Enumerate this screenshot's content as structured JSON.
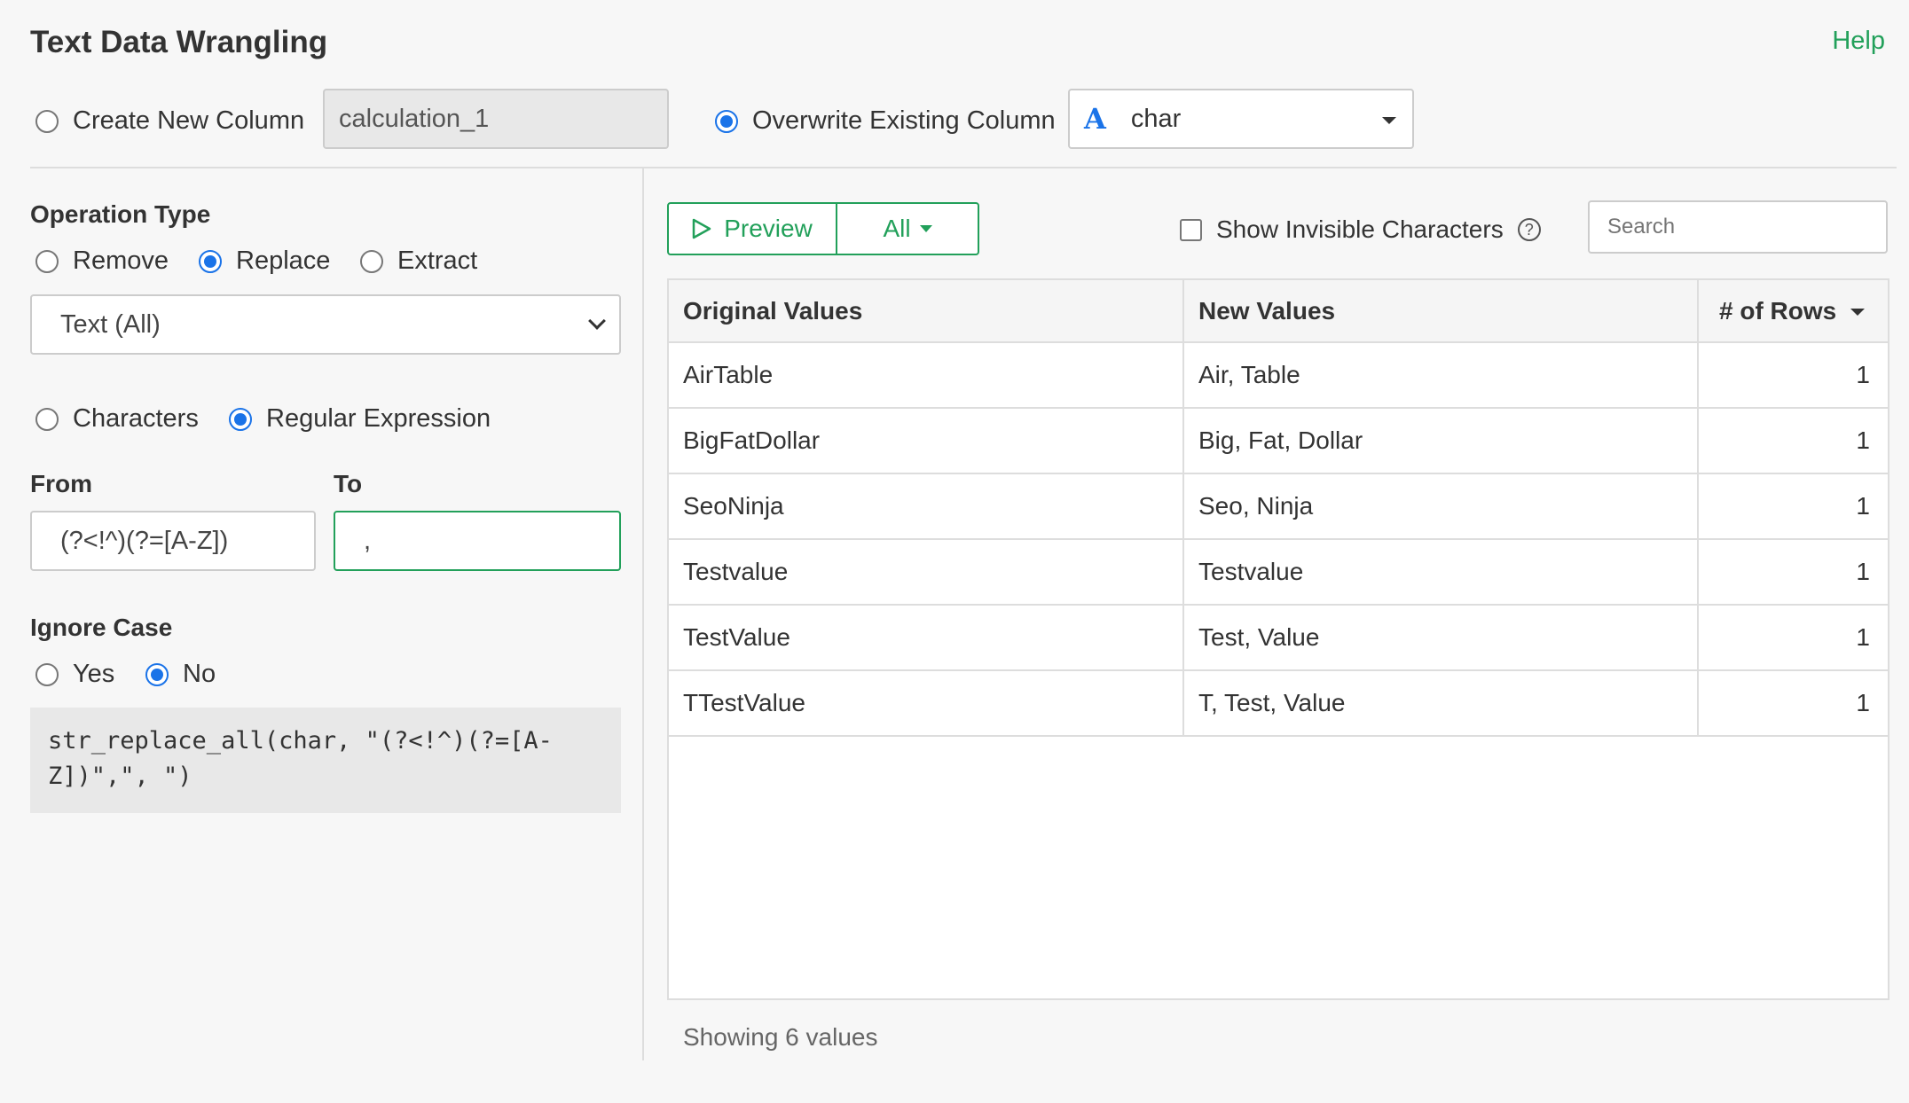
{
  "header": {
    "title": "Text Data Wrangling",
    "help_label": "Help"
  },
  "column_mode": {
    "create_label": "Create New Column",
    "create_value": "calculation_1",
    "overwrite_label": "Overwrite Existing Column",
    "selected": "overwrite",
    "column_type_icon": "A",
    "column_name": "char"
  },
  "operation": {
    "label": "Operation Type",
    "options": [
      "Remove",
      "Replace",
      "Extract"
    ],
    "selected": "Replace",
    "target_select": "Text (All)"
  },
  "match_mode": {
    "options": [
      "Characters",
      "Regular Expression"
    ],
    "selected": "Regular Expression"
  },
  "replace": {
    "from_label": "From",
    "from_value": "(?<!^)(?=[A-Z])",
    "to_label": "To",
    "to_value": ","
  },
  "ignore_case": {
    "label": "Ignore Case",
    "options": [
      "Yes",
      "No"
    ],
    "selected": "No"
  },
  "code": "str_replace_all(char, \"(?<!^)(?=[A-Z])\",\", \")",
  "toolbar": {
    "preview_label": "Preview",
    "filter_label": "All",
    "invisible_label": "Show Invisible Characters",
    "search_placeholder": "Search"
  },
  "table": {
    "headers": [
      "Original Values",
      "New Values",
      "# of Rows"
    ],
    "rows": [
      {
        "original": "AirTable",
        "new": "Air, Table",
        "count": "1"
      },
      {
        "original": "BigFatDollar",
        "new": "Big, Fat, Dollar",
        "count": "1"
      },
      {
        "original": "SeoNinja",
        "new": "Seo, Ninja",
        "count": "1"
      },
      {
        "original": "Testvalue",
        "new": "Testvalue",
        "count": "1"
      },
      {
        "original": "TestValue",
        "new": "Test, Value",
        "count": "1"
      },
      {
        "original": "TTestValue",
        "new": "T, Test, Value",
        "count": "1"
      }
    ]
  },
  "footer": "Showing 6 values",
  "colors": {
    "accent_green": "#22a05a",
    "radio_blue": "#1a73e8",
    "type_icon_blue": "#1a73e8"
  }
}
